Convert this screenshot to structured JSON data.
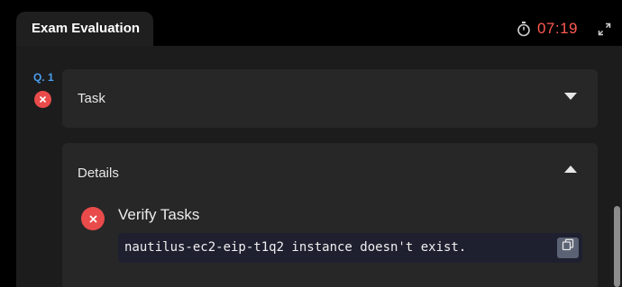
{
  "header": {
    "tab_label": "Exam Evaluation",
    "timer": "07:19",
    "timer_icon": "stopwatch-icon",
    "expand_icon": "expand-icon"
  },
  "question": {
    "number_label": "Q. 1",
    "status_icon": "x-circle-icon"
  },
  "task_card": {
    "title": "Task",
    "toggle_icon": "chevron-down-icon"
  },
  "details_card": {
    "title": "Details",
    "toggle_icon": "chevron-up-icon",
    "verify": {
      "title": "Verify Tasks",
      "status_icon": "x-circle-icon",
      "message": "nautilus-ec2-eip-t1q2 instance doesn't exist.",
      "copy_icon": "copy-icon"
    }
  },
  "colors": {
    "accent_blue": "#4b9df0",
    "error_red": "#e94b4b",
    "timer_red": "#ff5a52"
  }
}
